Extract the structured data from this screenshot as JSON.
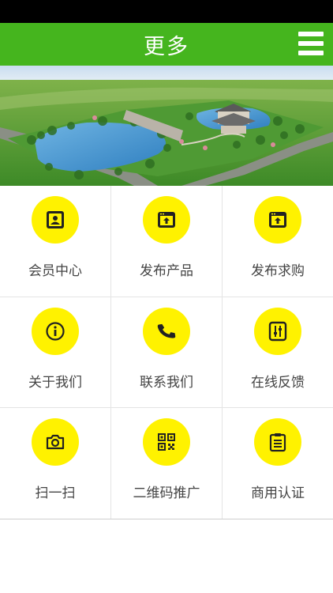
{
  "header": {
    "title": "更多",
    "menu_icon": "hamburger-menu-icon",
    "background_color": "#45b51e"
  },
  "banner": {
    "image": "landscape-park-aerial-photo"
  },
  "menu": {
    "icon_background_color": "#fff200",
    "items": [
      {
        "label": "会员中心",
        "icon": "member-card-icon"
      },
      {
        "label": "发布产品",
        "icon": "publish-upload-icon"
      },
      {
        "label": "发布求购",
        "icon": "publish-upload-icon"
      },
      {
        "label": "关于我们",
        "icon": "info-icon"
      },
      {
        "label": "联系我们",
        "icon": "phone-icon"
      },
      {
        "label": "在线反馈",
        "icon": "feedback-sliders-icon"
      },
      {
        "label": "扫一扫",
        "icon": "camera-icon"
      },
      {
        "label": "二维码推广",
        "icon": "qr-code-icon"
      },
      {
        "label": "商用认证",
        "icon": "clipboard-icon"
      }
    ]
  }
}
